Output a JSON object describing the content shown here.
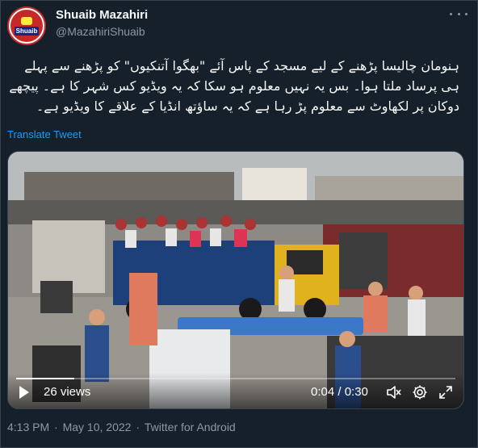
{
  "author": {
    "name": "Shuaib Mazahiri",
    "handle": "@MazahiriShuaib",
    "avatar_badge": "Shuaib"
  },
  "tweet": {
    "text": "ہنومان چالیسا پڑھنے کے لیے مسجد کے پاس آئے \"بھگوا آتنکیوں\" کو پڑھنے سے پہلے ہی پرساد ملتا ہوا۔ بس یہ نہیں معلوم ہو سکا کہ یہ ویڈیو کس شہر کا ہے۔ پیچھے دوکان پر لکھاوٹ سے معلوم پڑ رہا ہے کہ یہ ساؤتھ انڈیا کے علاقے کا ویڈیو ہے۔",
    "translate_label": "Translate Tweet"
  },
  "video": {
    "views": "26 views",
    "time": "0:04 / 0:30",
    "progress": 0.133,
    "icons": [
      "play-icon",
      "mute-icon",
      "settings-icon",
      "fullscreen-icon"
    ]
  },
  "meta": {
    "time": "4:13 PM",
    "date": "May 10, 2022",
    "client": "Twitter for Android"
  },
  "colors": {
    "background": "#15202b",
    "accent": "#1d9bf0",
    "secondary_text": "#8b98a5",
    "border": "#38444d"
  }
}
